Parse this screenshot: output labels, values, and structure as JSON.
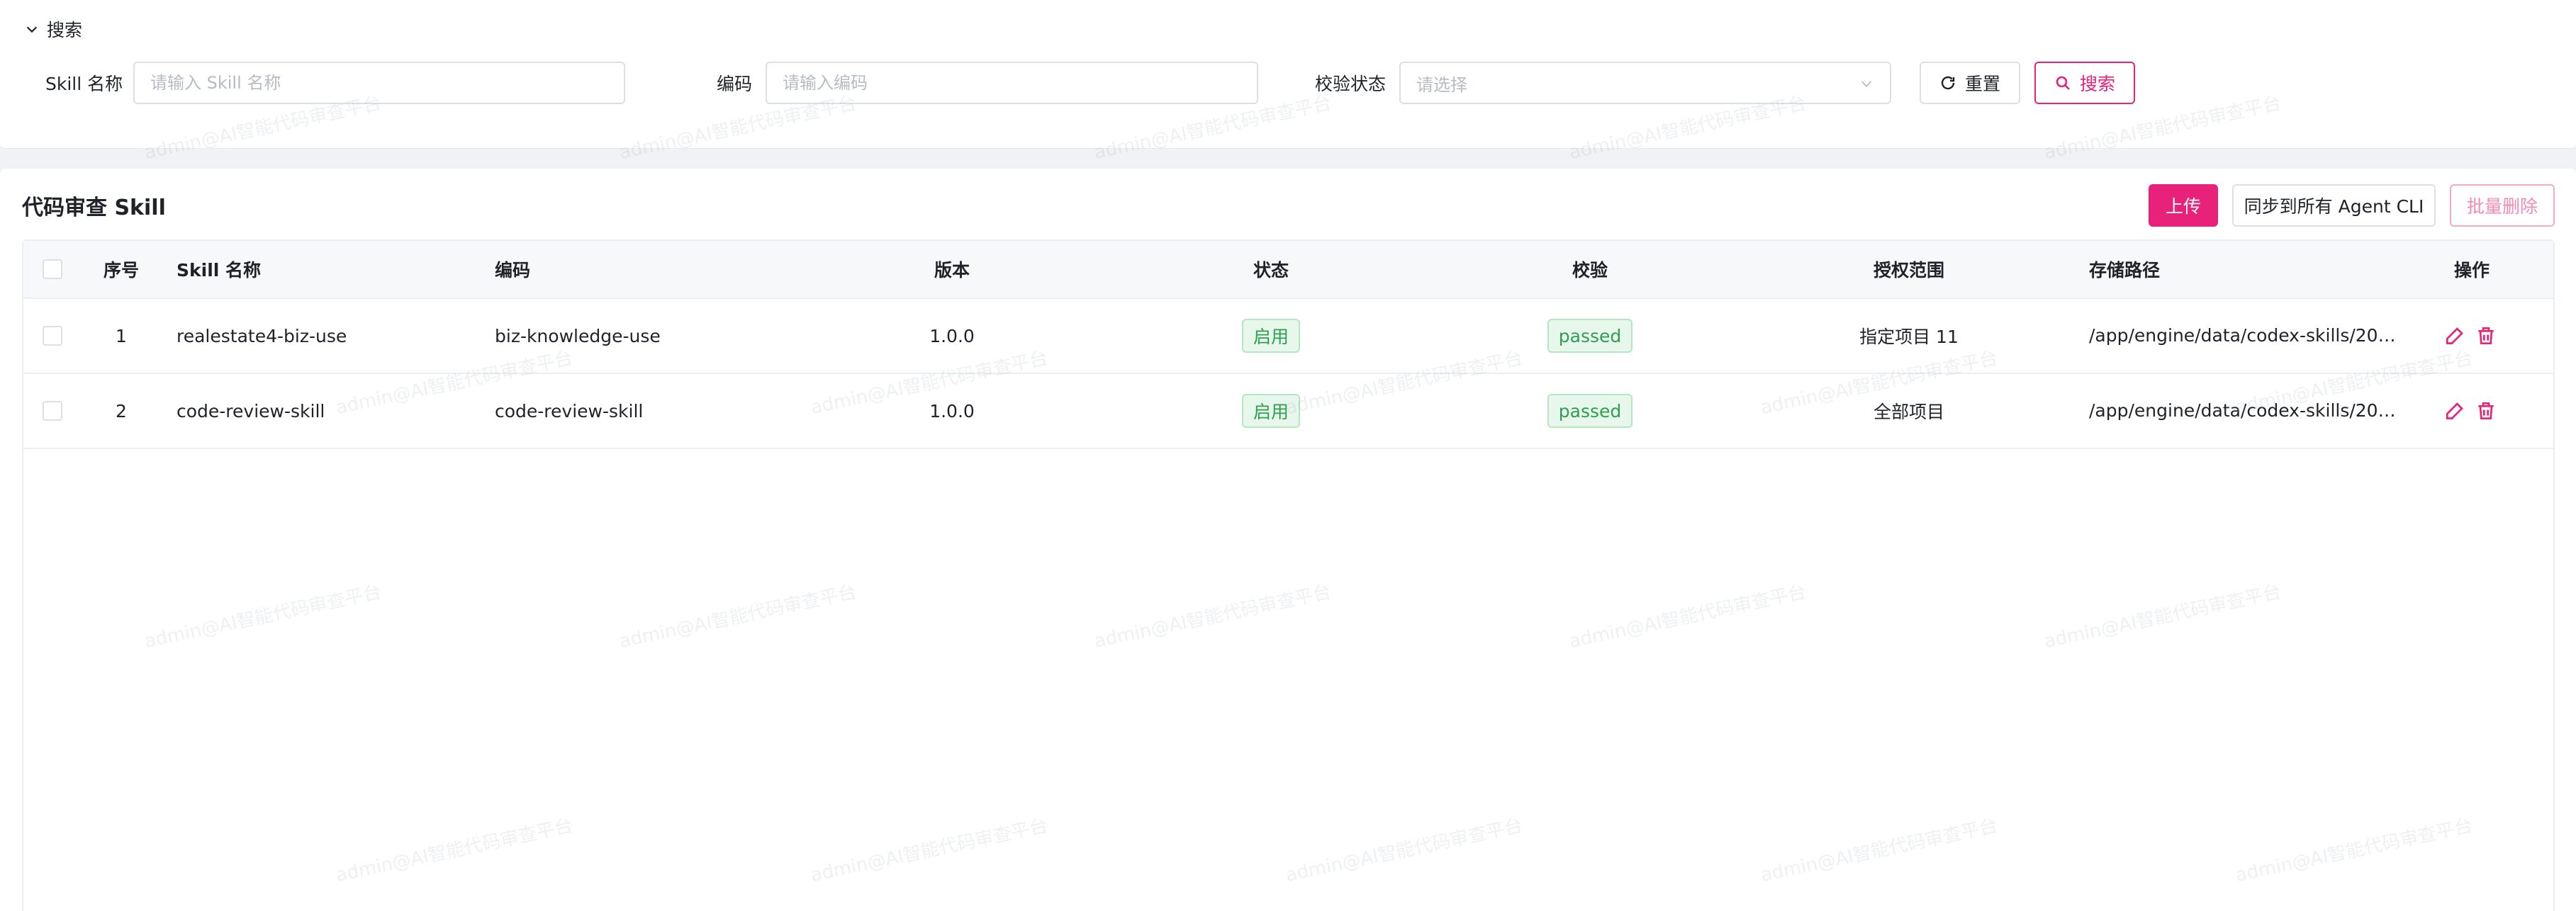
{
  "search": {
    "toggle_label": "搜索",
    "skill_name_label": "Skill 名称",
    "skill_name_placeholder": "请输入 Skill 名称",
    "code_label": "编码",
    "code_placeholder": "请输入编码",
    "status_label": "校验状态",
    "status_placeholder": "请选择",
    "reset_label": "重置",
    "search_label": "搜索"
  },
  "table_card": {
    "title": "代码审查 Skill",
    "upload_label": "上传",
    "sync_label": "同步到所有 Agent CLI",
    "batch_delete_label": "批量删除"
  },
  "table": {
    "headers": {
      "index": "序号",
      "name": "Skill 名称",
      "code": "编码",
      "version": "版本",
      "status": "状态",
      "check": "校验",
      "scope": "授权范围",
      "path": "存储路径",
      "actions": "操作"
    },
    "rows": [
      {
        "index": "1",
        "name": "realestate4-biz-use",
        "code": "biz-knowledge-use",
        "version": "1.0.0",
        "status": "启用",
        "check": "passed",
        "scope": "指定项目 11",
        "path": "/app/engine/data/codex-skills/20…"
      },
      {
        "index": "2",
        "name": "code-review-skill",
        "code": "code-review-skill",
        "version": "1.0.0",
        "status": "启用",
        "check": "passed",
        "scope": "全部项目",
        "path": "/app/engine/data/codex-skills/20…"
      }
    ]
  },
  "watermark": "admin@AI智能代码审查平台",
  "colors": {
    "primary": "#e8217a",
    "success_text": "#2f9e4f",
    "success_bg": "#e8f7ec"
  }
}
